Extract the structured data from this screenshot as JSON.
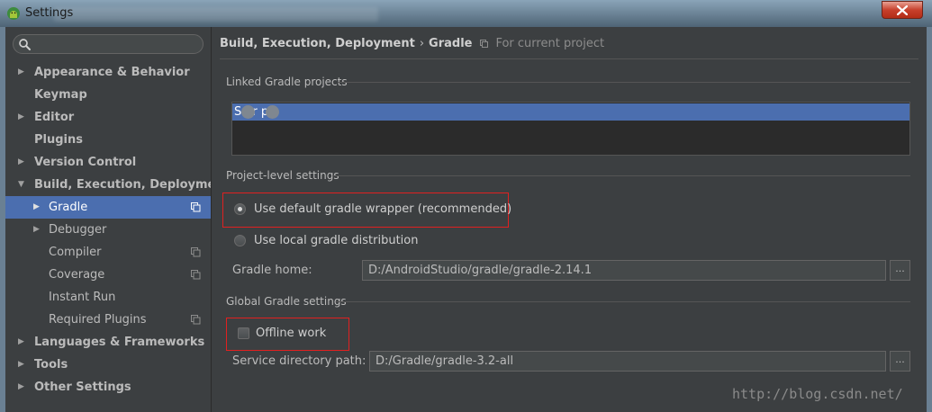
{
  "window": {
    "title": "Settings",
    "icon": "android-icon",
    "close_icon": "close-icon"
  },
  "sidebar": {
    "search": {
      "value": "",
      "placeholder": "",
      "icon": "search-icon"
    },
    "items": [
      {
        "label": "Appearance & Behavior",
        "level": 0,
        "arrow": "▶",
        "expanded": false
      },
      {
        "label": "Keymap",
        "level": 0,
        "arrow": ""
      },
      {
        "label": "Editor",
        "level": 0,
        "arrow": "▶",
        "expanded": false
      },
      {
        "label": "Plugins",
        "level": 0,
        "arrow": ""
      },
      {
        "label": "Version Control",
        "level": 0,
        "arrow": "▶",
        "expanded": false
      },
      {
        "label": "Build, Execution, Deployment",
        "level": 0,
        "arrow": "▼",
        "expanded": true
      },
      {
        "label": "Gradle",
        "level": 1,
        "arrow": "▶",
        "selected": true,
        "project_icon": true
      },
      {
        "label": "Debugger",
        "level": 1,
        "arrow": "▶"
      },
      {
        "label": "Compiler",
        "level": 1,
        "arrow": "",
        "project_icon": true
      },
      {
        "label": "Coverage",
        "level": 1,
        "arrow": "",
        "project_icon": true
      },
      {
        "label": "Instant Run",
        "level": 1,
        "arrow": ""
      },
      {
        "label": "Required Plugins",
        "level": 1,
        "arrow": "",
        "project_icon": true
      },
      {
        "label": "Languages & Frameworks",
        "level": 0,
        "arrow": "▶",
        "expanded": false
      },
      {
        "label": "Tools",
        "level": 0,
        "arrow": "▶",
        "expanded": false
      },
      {
        "label": "Other Settings",
        "level": 0,
        "arrow": "▶",
        "expanded": false
      }
    ]
  },
  "main": {
    "breadcrumb": {
      "parent": "Build, Execution, Deployment",
      "separator": "›",
      "current": "Gradle",
      "scope": "For current project",
      "scope_icon": "project-scope-icon"
    },
    "linked_projects": {
      "title": "Linked Gradle projects",
      "items": [
        "S   er   ps"
      ]
    },
    "project_level": {
      "title": "Project-level settings",
      "options": [
        {
          "label": "Use default gradle wrapper (recommended)",
          "checked": true
        },
        {
          "label": "Use local gradle distribution",
          "checked": false
        }
      ],
      "gradle_home": {
        "label": "Gradle home:",
        "value": "D:/AndroidStudio/gradle/gradle-2.14.1",
        "browse": "..."
      }
    },
    "global": {
      "title": "Global Gradle settings",
      "offline_work": {
        "label": "Offline work",
        "checked": false
      },
      "service_dir": {
        "label": "Service directory path:",
        "value": "D:/Gradle/gradle-3.2-all",
        "browse": "..."
      }
    }
  },
  "watermark": "http://blog.csdn.net/",
  "colors": {
    "background": "#3c3f41",
    "selection": "#4b6eaf",
    "highlight_box": "#e02020",
    "text": "#bbbbbb"
  }
}
